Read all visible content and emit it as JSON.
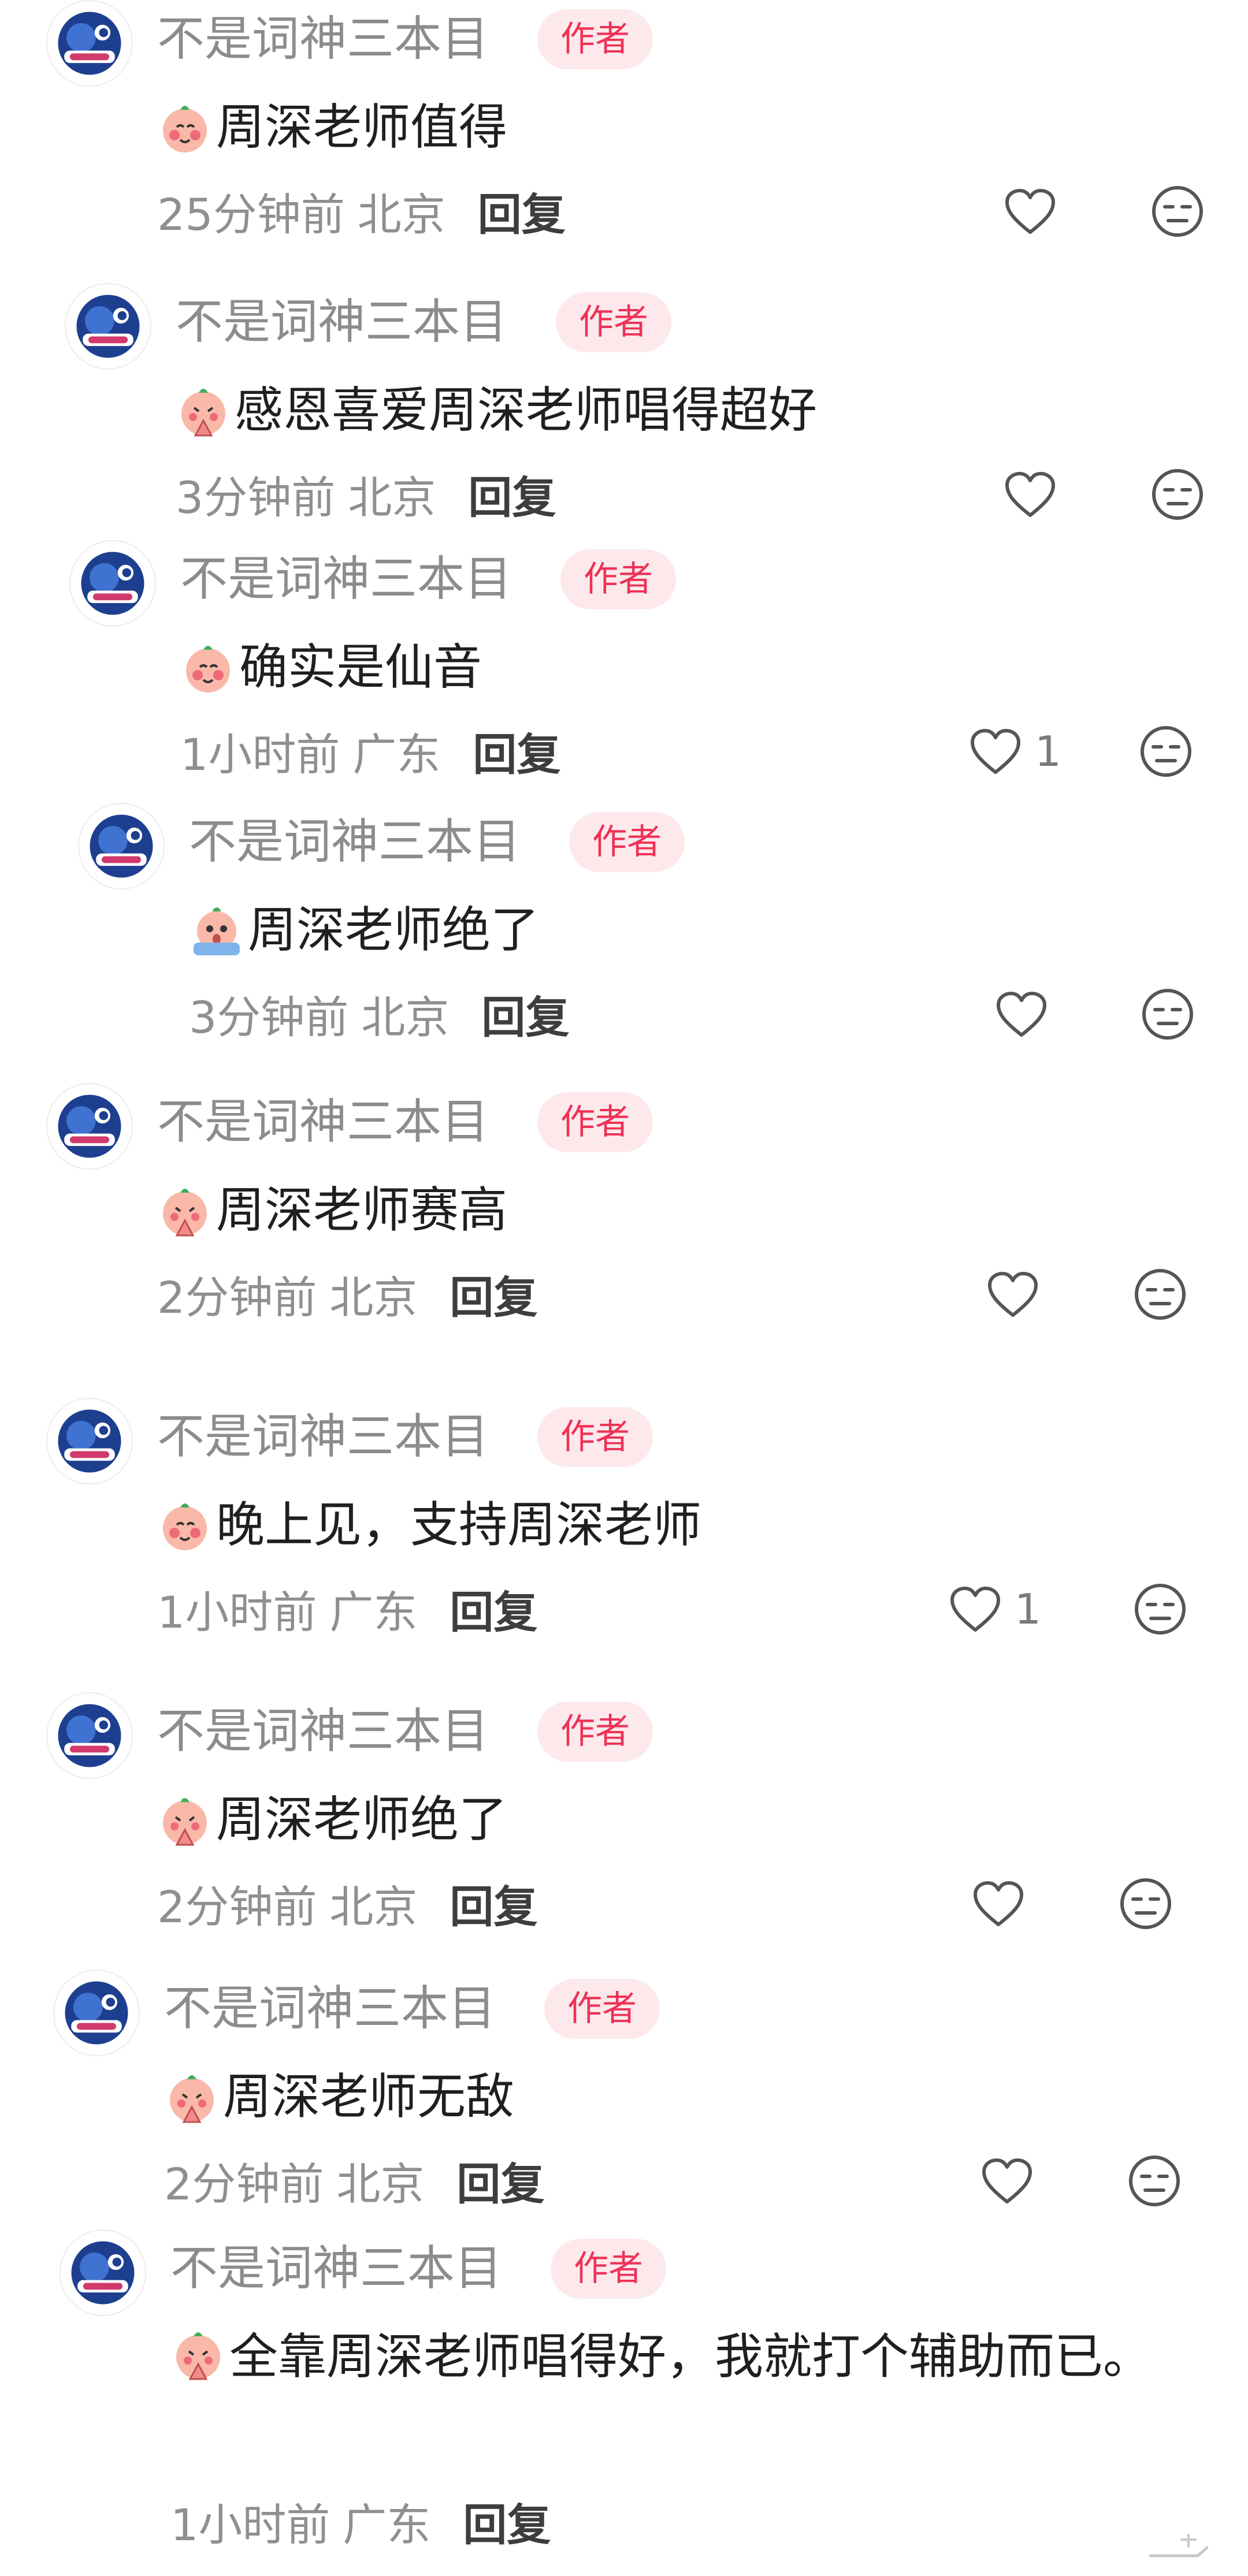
{
  "colors": {
    "accent": "#ef3156",
    "badge_bg": "#fde9ec",
    "meta_text": "#8f8f8f",
    "body_text": "#1f1f1f"
  },
  "comments": [
    {
      "username": "不是词神三本目",
      "badge": "作者",
      "emoji": "peach-blush-icon",
      "text": "周深老师值得",
      "time": "25分钟前",
      "location": "北京",
      "reply": "回复",
      "likes": ""
    },
    {
      "username": "不是词神三本目",
      "badge": "作者",
      "emoji": "peach-pray-icon",
      "text": "感恩喜爱周深老师唱得超好",
      "time": "3分钟前",
      "location": "北京",
      "reply": "回复",
      "likes": ""
    },
    {
      "username": "不是词神三本目",
      "badge": "作者",
      "emoji": "peach-blush-icon",
      "text": "确实是仙音",
      "time": "1小时前",
      "location": "广东",
      "reply": "回复",
      "likes": "1"
    },
    {
      "username": "不是词神三本目",
      "badge": "作者",
      "emoji": "peach-shocked-icon",
      "text": "周深老师绝了",
      "time": "3分钟前",
      "location": "北京",
      "reply": "回复",
      "likes": ""
    },
    {
      "username": "不是词神三本目",
      "badge": "作者",
      "emoji": "peach-pray-icon",
      "text": "周深老师赛高",
      "time": "2分钟前",
      "location": "北京",
      "reply": "回复",
      "likes": ""
    },
    {
      "username": "不是词神三本目",
      "badge": "作者",
      "emoji": "peach-blush-icon",
      "text": "晚上见，支持周深老师",
      "time": "1小时前",
      "location": "广东",
      "reply": "回复",
      "likes": "1"
    },
    {
      "username": "不是词神三本目",
      "badge": "作者",
      "emoji": "peach-pray-icon",
      "text": "周深老师绝了",
      "time": "2分钟前",
      "location": "北京",
      "reply": "回复",
      "likes": ""
    },
    {
      "username": "不是词神三本目",
      "badge": "作者",
      "emoji": "peach-pray-icon",
      "text": "周深老师无敌",
      "time": "2分钟前",
      "location": "北京",
      "reply": "回复",
      "likes": ""
    },
    {
      "username": "不是词神三本目",
      "badge": "作者",
      "emoji": "peach-pray-icon",
      "text": "全靠周深老师唱得好，我就打个辅助而已。",
      "time": "1小时前",
      "location": "广东",
      "reply": "回复",
      "likes": ""
    }
  ]
}
